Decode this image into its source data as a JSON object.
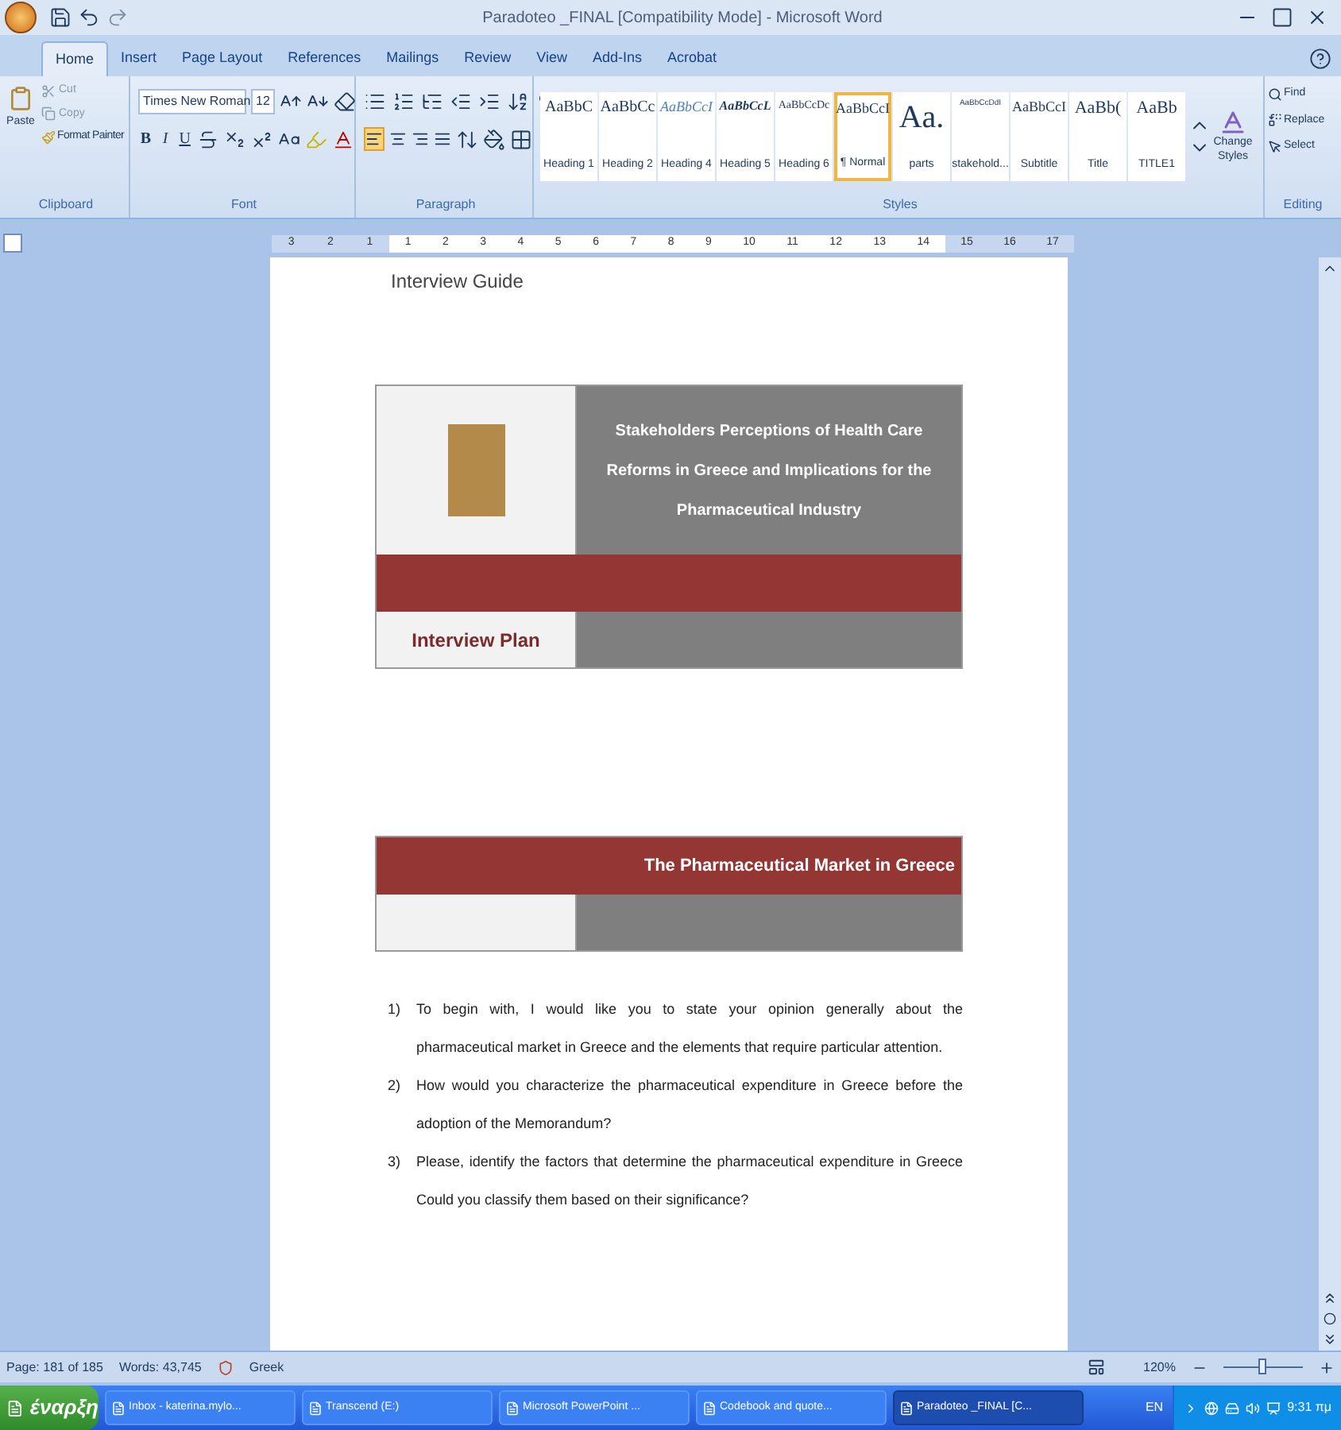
{
  "window": {
    "title": "Paradoteo _FINAL [Compatibility Mode] - Microsoft Word"
  },
  "tabs": [
    {
      "label": "Home",
      "selected": true
    },
    {
      "label": "Insert",
      "selected": false
    },
    {
      "label": "Page Layout",
      "selected": false
    },
    {
      "label": "References",
      "selected": false
    },
    {
      "label": "Mailings",
      "selected": false
    },
    {
      "label": "Review",
      "selected": false
    },
    {
      "label": "View",
      "selected": false
    },
    {
      "label": "Add-Ins",
      "selected": false
    },
    {
      "label": "Acrobat",
      "selected": false
    }
  ],
  "clipboard": {
    "title": "Clipboard",
    "paste": "Paste",
    "cut": "Cut",
    "copy": "Copy",
    "format_painter": "Format Painter"
  },
  "font": {
    "title": "Font",
    "font_name": "Times New Roman",
    "font_size": "12",
    "bold": "B",
    "italic": "I",
    "underline": "U"
  },
  "paragraph": {
    "title": "Paragraph",
    "alignments": [
      {
        "kind": "left",
        "selected": true
      },
      {
        "kind": "center",
        "selected": false
      },
      {
        "kind": "right",
        "selected": false
      },
      {
        "kind": "justify",
        "selected": false
      }
    ]
  },
  "styles": {
    "title": "Styles",
    "items": [
      {
        "sample": "AaBbC",
        "label": "Heading 1",
        "kind": "heading",
        "selected": false
      },
      {
        "sample": "AaBbCc",
        "label": "Heading 2",
        "kind": "heading",
        "selected": false
      },
      {
        "sample": "AaBbCcI",
        "label": "Heading 4",
        "kind": "italic",
        "selected": false
      },
      {
        "sample": "AaBbCcL",
        "label": "Heading 5",
        "kind": "bolditalic",
        "selected": false
      },
      {
        "sample": "AaBbCcDc",
        "label": "Heading 6",
        "kind": "small",
        "selected": false
      },
      {
        "sample": "AaBbCcI",
        "label": "¶ Normal",
        "kind": "normal",
        "selected": true
      },
      {
        "sample": "Aa.",
        "label": "parts",
        "kind": "huge",
        "selected": false
      },
      {
        "sample": "AaBbCcDdI",
        "label": "stakehold...",
        "kind": "tiny",
        "selected": false
      },
      {
        "sample": "AaBbCcI",
        "label": "Subtitle",
        "kind": "normal",
        "selected": false
      },
      {
        "sample": "AaBb(",
        "label": "Title",
        "kind": "large",
        "selected": false
      },
      {
        "sample": "AaBb",
        "label": "TITLE1",
        "kind": "large",
        "selected": false
      }
    ],
    "change_styles": "Change Styles"
  },
  "editing": {
    "title": "Editing",
    "find": "Find",
    "replace": "Replace",
    "select": "Select"
  },
  "ruler": {
    "left_numbers": [
      "3",
      "2",
      "1"
    ],
    "numbers": [
      "1",
      "2",
      "3",
      "4",
      "5",
      "6",
      "7",
      "8",
      "9",
      "10",
      "11",
      "12",
      "13",
      "14"
    ],
    "right_numbers": [
      "15",
      "16",
      "17"
    ]
  },
  "document": {
    "header": "Interview Guide",
    "title_table": {
      "title": "Stakeholders Perceptions of Health Care Reforms in Greece and Implications for the Pharmaceutical Industry",
      "plan_label": "Interview Plan"
    },
    "section_table": {
      "title": "The Pharmaceutical Market in Greece"
    },
    "questions": [
      {
        "number": "1)",
        "text": "To begin with, I would like you to state your opinion generally about the pharmaceutical market in Greece and the elements that require particular attention."
      },
      {
        "number": "2)",
        "text": "How would you characterize the pharmaceutical expenditure in Greece before the adoption of the Memorandum?"
      },
      {
        "number": "3)",
        "text": "Please, identify the factors that determine the pharmaceutical expenditure in Greece Could you classify them based on their significance?"
      }
    ]
  },
  "status_bar": {
    "page": "Page: 181 of 185",
    "words": "Words: 43,745",
    "language": "Greek",
    "zoom": "120%",
    "zoom_slider": {
      "level": 0.5
    }
  },
  "taskbar": {
    "start": "έναρξη",
    "items": [
      {
        "label": "Inbox - katerina.mylo...",
        "selected": false
      },
      {
        "label": "Transcend (E:)",
        "selected": false
      },
      {
        "label": "Microsoft PowerPoint ...",
        "selected": false
      },
      {
        "label": "Codebook and quote...",
        "selected": false
      },
      {
        "label": "Paradoteo _FINAL [C...",
        "selected": true
      }
    ],
    "language": "EN",
    "clock": "9:31 πμ"
  }
}
